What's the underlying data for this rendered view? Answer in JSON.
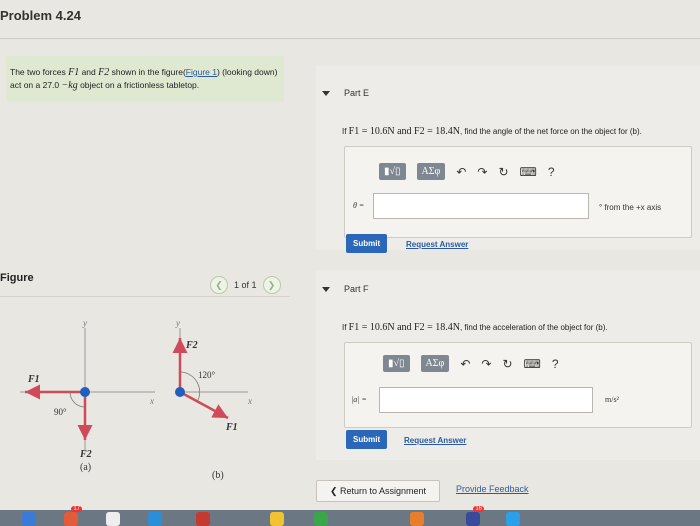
{
  "page": {
    "title": "Problem 4.24"
  },
  "intro": {
    "text_a": "The two forces ",
    "f1": "F1",
    "text_b": " and ",
    "f2": "F2",
    "text_c": " shown in the figure(",
    "figure_link": "Figure 1",
    "text_d": ") (looking down) act on a 27.0 ",
    "unit": "−kg",
    "text_e": " object on a frictionless tabletop."
  },
  "figure": {
    "label": "Figure",
    "pager": "1 of 1",
    "prev_icon": "chevron-left-icon",
    "next_icon": "chevron-right-icon",
    "fig_a": {
      "y": "y",
      "x": "x",
      "f1": "F1",
      "f2": "F2",
      "angle": "90°",
      "caption": "(a)"
    },
    "fig_b": {
      "y": "y",
      "x": "x",
      "f1": "F1",
      "f2": "F2",
      "angle": "120°",
      "caption": "(b)"
    }
  },
  "partE": {
    "header": "Part E",
    "question_prefix": "If ",
    "question_math": "F1 = 10.6N and F2 = 18.4N",
    "question_suffix": ", find the angle of the net force on the object for (b).",
    "toolbar": {
      "sqrt": "▮√▯",
      "greek": "ΑΣφ",
      "help": "?"
    },
    "input_label": "θ =",
    "input_value": "",
    "suffix": "° from the +x axis",
    "submit": "Submit",
    "request": "Request Answer"
  },
  "partF": {
    "header": "Part F",
    "question_prefix": "If ",
    "question_math": "F1 = 10.6N and F2 = 18.4N",
    "question_suffix": ", find the acceleration of the object for (b).",
    "toolbar": {
      "sqrt": "▮√▯",
      "greek": "ΑΣφ",
      "help": "?"
    },
    "input_label": "|a| =",
    "input_value": "",
    "unit": "m/s²",
    "submit": "Submit",
    "request": "Request Answer"
  },
  "footer": {
    "return": "❮ Return to Assignment",
    "feedback": "Provide Feedback"
  },
  "dock": {
    "badge_1": "17",
    "badge_2": "16"
  },
  "colors": {
    "accent": "#2b67b8",
    "intro_bg": "#dfe9d2",
    "vector_red": "#d04a5a",
    "origin_blue": "#1f5fbf"
  }
}
